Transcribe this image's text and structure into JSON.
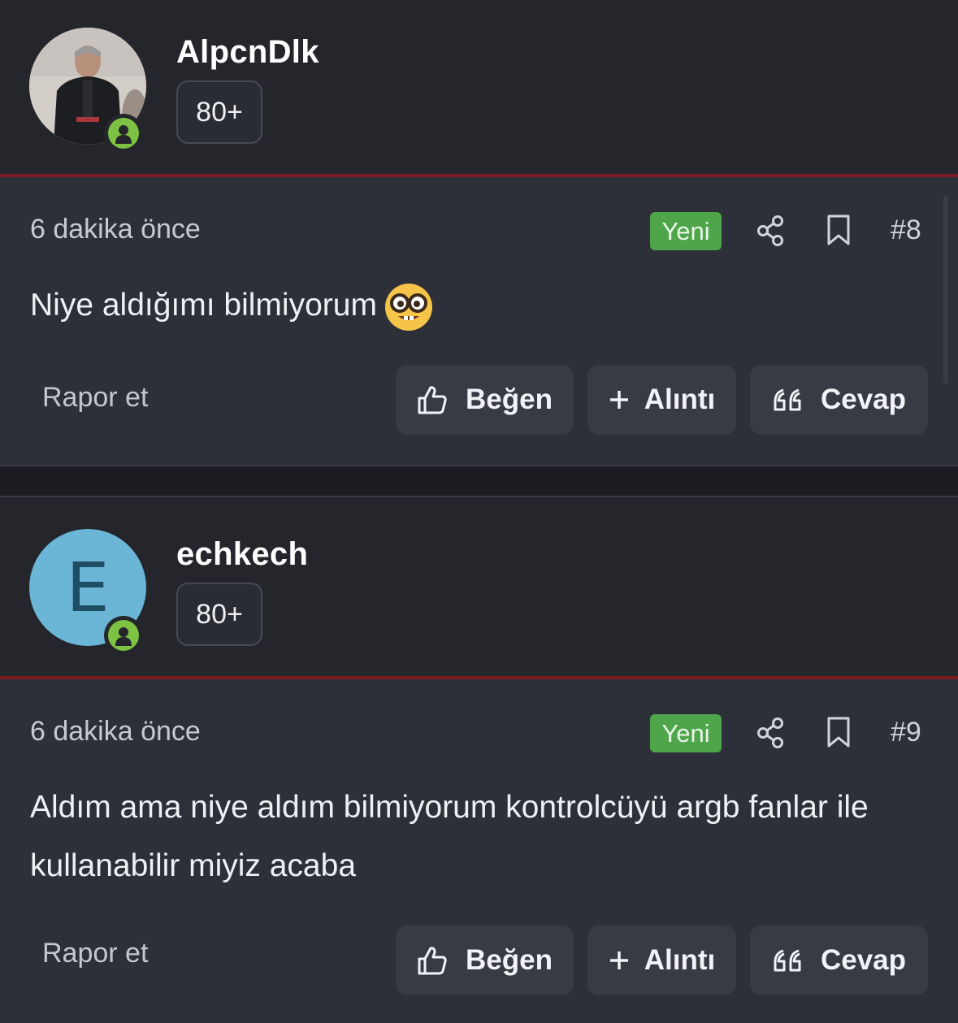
{
  "posts": [
    {
      "username": "AlpcnDlk",
      "rank": "80+",
      "avatar": {
        "type": "photo"
      },
      "time": "6 dakika önce",
      "badge": "Yeni",
      "number": "#8",
      "message": "Niye aldığımı bilmiyorum",
      "message_emoji": "nerd-face",
      "report": "Rapor et",
      "like_label": "Beğen",
      "quote_label": "Alıntı",
      "reply_label": "Cevap"
    },
    {
      "username": "echkech",
      "rank": "80+",
      "avatar": {
        "type": "letter",
        "letter": "E",
        "color": "#6bb5d6"
      },
      "time": "6 dakika önce",
      "badge": "Yeni",
      "number": "#9",
      "message": "Aldım ama niye aldım bilmiyorum kontrolcüyü argb fanlar ile kullanabilir miyiz acaba",
      "report": "Rapor et",
      "like_label": "Beğen",
      "quote_label": "Alıntı",
      "reply_label": "Cevap"
    }
  ],
  "colors": {
    "accent_red": "#7a1c1f",
    "new_badge": "#4ea54a",
    "online": "#7dc243"
  },
  "icons": [
    "user-online-icon",
    "share-icon",
    "bookmark-icon",
    "thumbs-up-icon",
    "plus-icon",
    "quote-icon"
  ]
}
